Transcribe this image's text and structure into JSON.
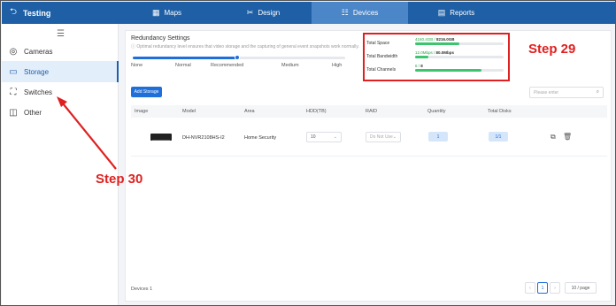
{
  "topbar": {
    "back_icon": "return-icon",
    "title": "Testing",
    "tabs": [
      {
        "label": "Maps",
        "icon": "map-icon"
      },
      {
        "label": "Design",
        "icon": "design-icon"
      },
      {
        "label": "Devices",
        "icon": "devices-icon",
        "active": true
      },
      {
        "label": "Reports",
        "icon": "reports-icon"
      }
    ]
  },
  "sidebar": {
    "items": [
      {
        "label": "Cameras",
        "icon": "camera-icon"
      },
      {
        "label": "Storage",
        "icon": "storage-icon",
        "active": true
      },
      {
        "label": "Switches",
        "icon": "switch-icon"
      },
      {
        "label": "Other",
        "icon": "other-icon"
      }
    ]
  },
  "redundancy": {
    "title": "Redundancy Settings",
    "description": "Optimal redundancy level ensures that video storage and the capturing of general event snapshots work normally.",
    "levels": [
      "None",
      "Normal",
      "Recommended",
      "Medium",
      "High"
    ],
    "selected_level": "Recommended"
  },
  "stats": [
    {
      "label": "Total Space",
      "value": "4160.4GB",
      "total": "8216.0GB",
      "fill": 0.5
    },
    {
      "label": "Total Bandwidth",
      "value": "12.0Mbps",
      "total": "80.0Mbps",
      "fill": 0.15
    },
    {
      "label": "Total Channels",
      "value": "6",
      "total": "8",
      "fill": 0.75
    }
  ],
  "annotations": {
    "step29": "Step 29",
    "step30": "Step 30"
  },
  "toolbar": {
    "add_label": "Add Storage",
    "search_placeholder": "Please enter"
  },
  "table": {
    "headers": [
      "Image",
      "Model",
      "Area",
      "HDD(TB)",
      "RAID",
      "Quantity",
      "Total Disks"
    ],
    "rows": [
      {
        "model": "DH-NVR2108HS-I2",
        "area": "Home Security",
        "hdd": "10",
        "raid": "Do Not Use",
        "quantity": "1",
        "total_disks": "1/1"
      }
    ]
  },
  "footer": {
    "count": "Devices 1",
    "page": "1",
    "page_size": "10 / page"
  },
  "colors": {
    "topbar": "#1e5fa6",
    "accent": "#1e6fd9",
    "annotation": "#e02020",
    "progress": "#3cc46f"
  }
}
